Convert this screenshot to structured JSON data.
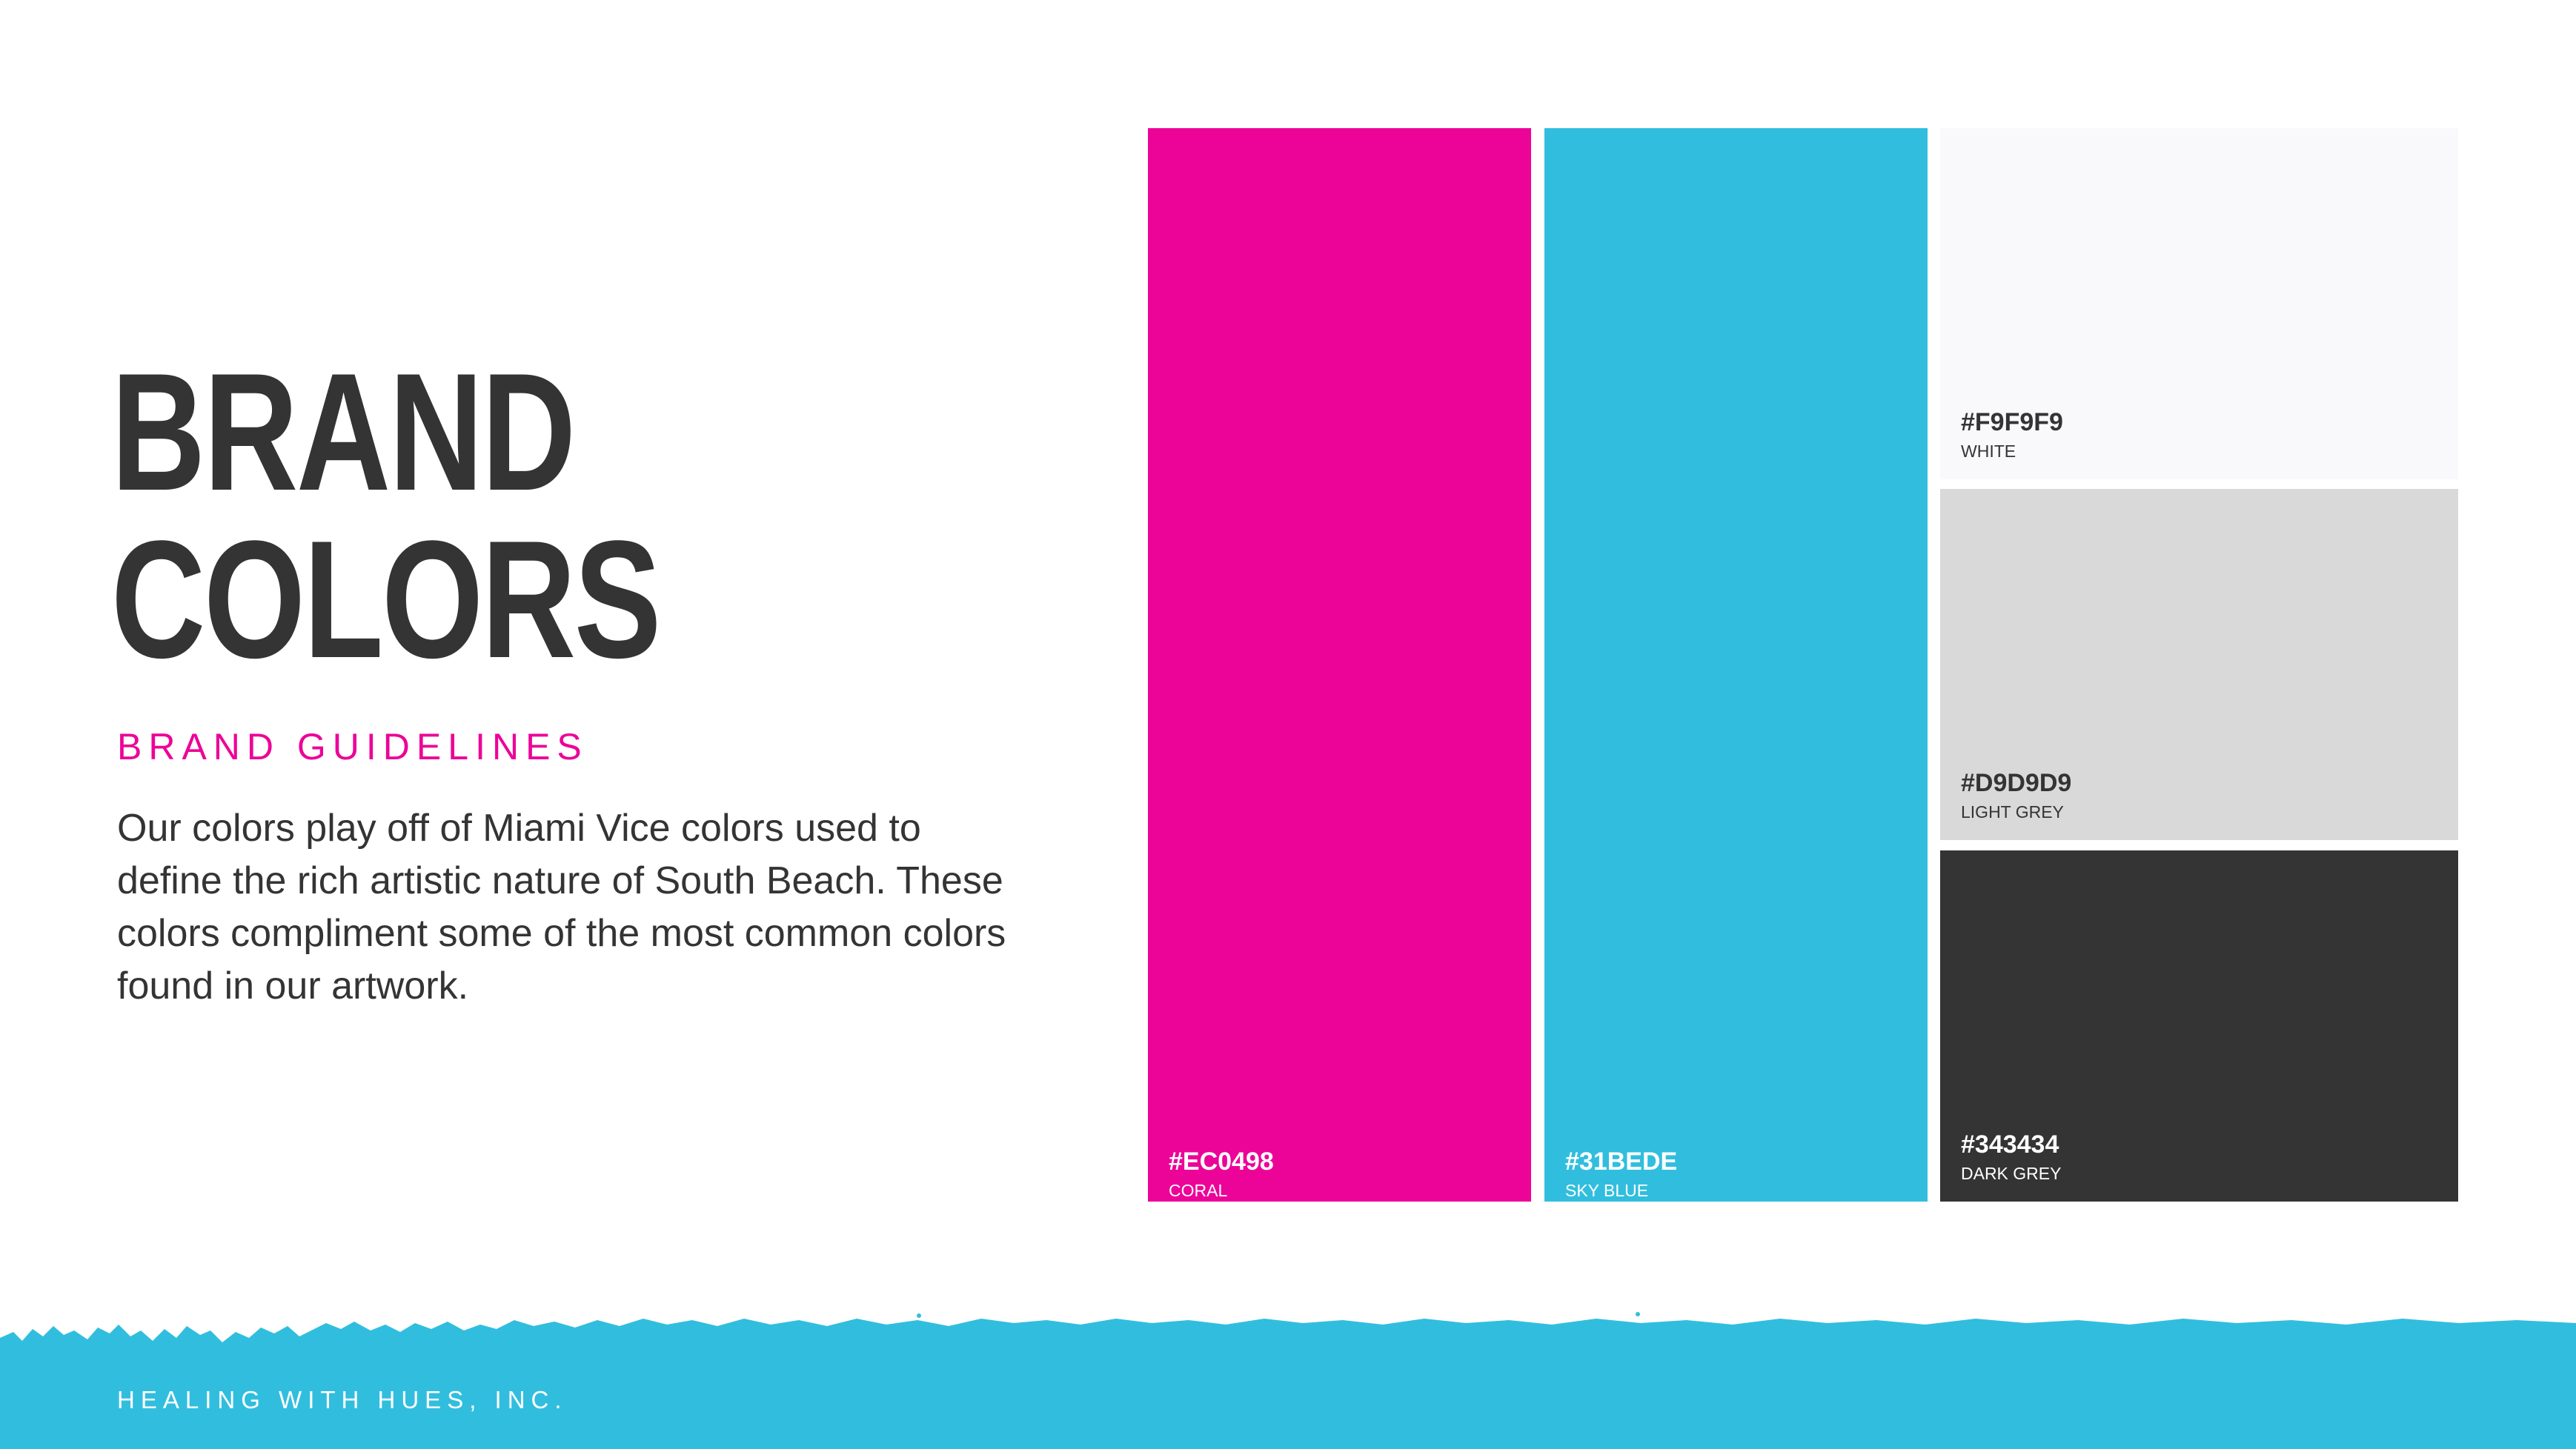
{
  "heading": {
    "line1": "BRAND",
    "line2": "COLORS"
  },
  "subheading": "BRAND GUIDELINES",
  "description": "Our colors play off of Miami Vice colors used to define the rich artistic nature of South Beach. These colors compliment some of the most common colors found in our artwork.",
  "swatches": [
    {
      "hex": "#EC0498",
      "name": "CORAL"
    },
    {
      "hex": "#31BEDE",
      "name": "SKY BLUE"
    },
    {
      "hex": "#F9F9F9",
      "name": "WHITE"
    },
    {
      "hex": "#D9D9D9",
      "name": "LIGHT GREY"
    },
    {
      "hex": "#343434",
      "name": "DARK GREY"
    }
  ],
  "footer": {
    "company": "HEALING WITH HUES, INC.",
    "band_color": "#31BEDE"
  },
  "colors": {
    "heading": "#343434",
    "subheading": "#EC0498",
    "background": "#FFFFFF"
  }
}
